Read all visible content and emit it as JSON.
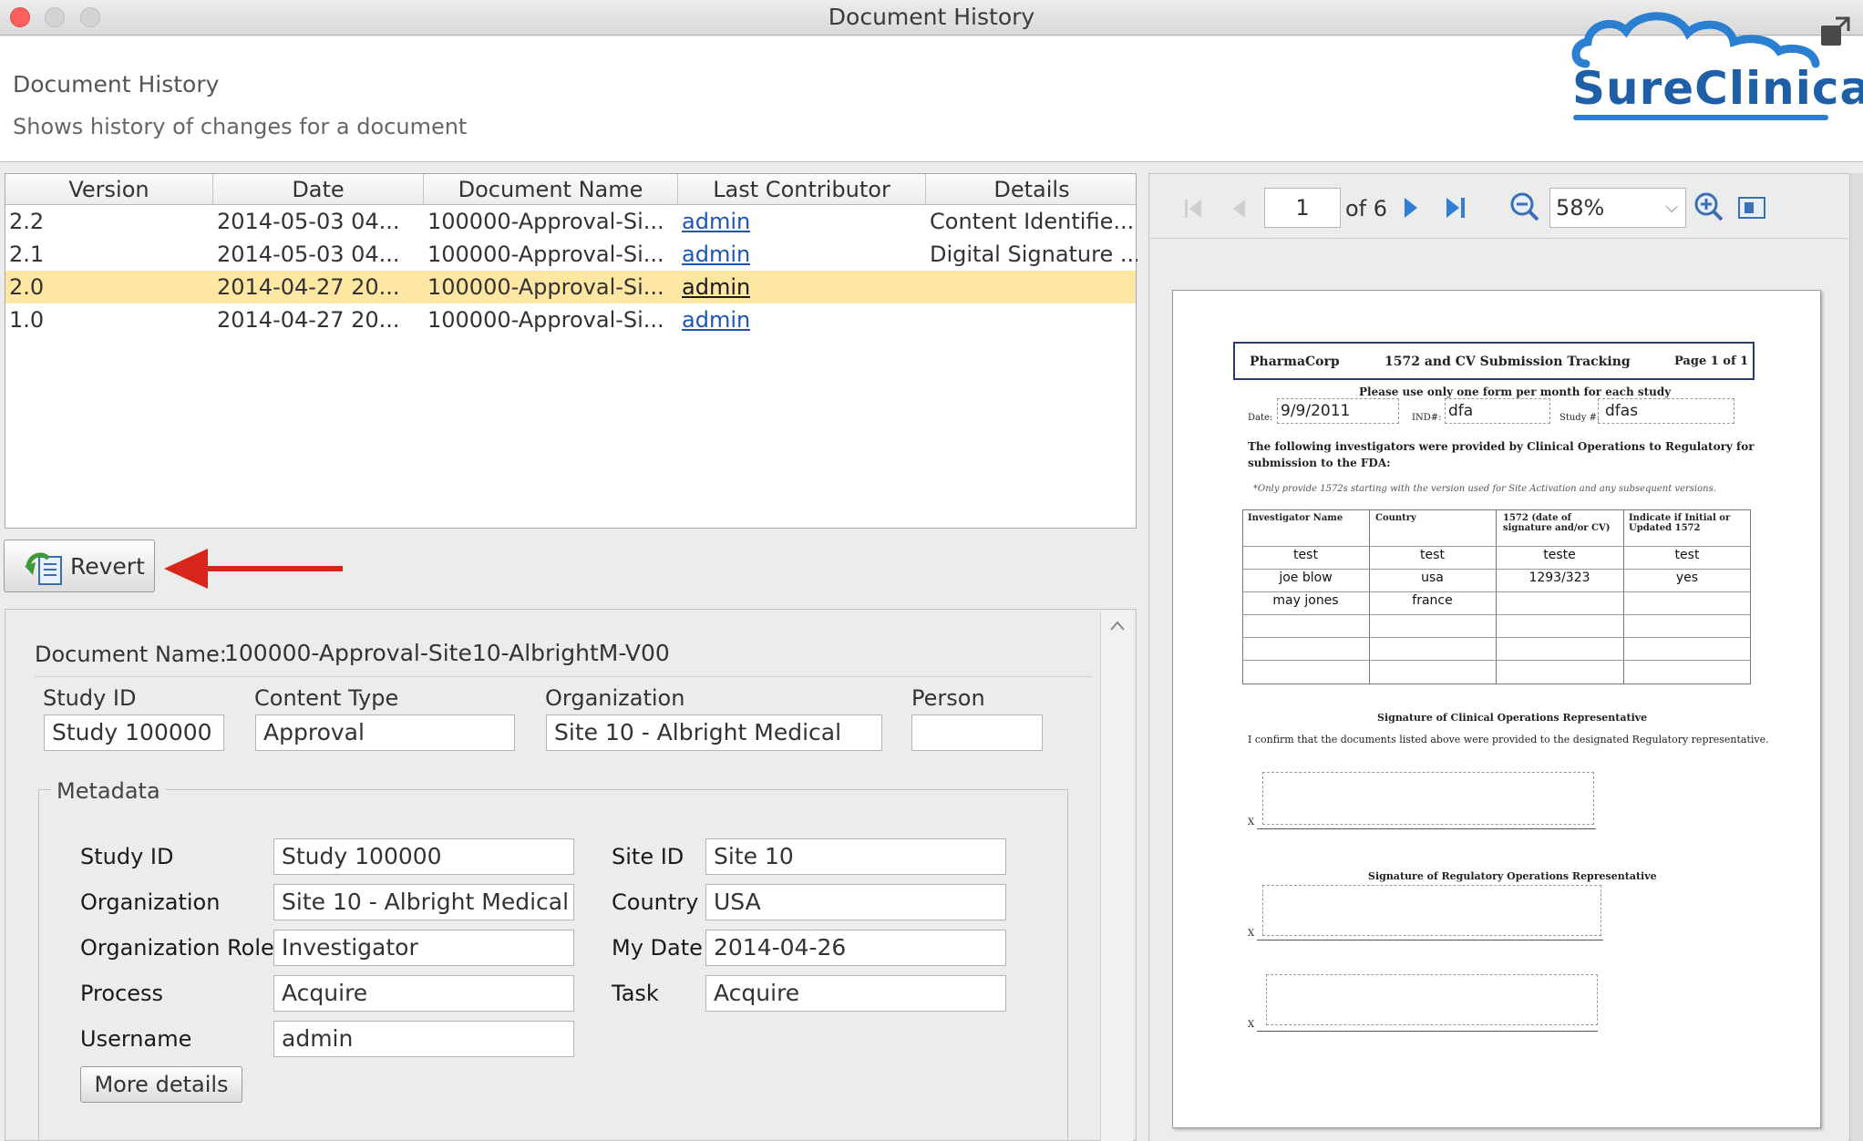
{
  "window": {
    "title": "Document History"
  },
  "header": {
    "title": "Document History",
    "subtitle": "Shows history of changes for a document",
    "logo_text": "SureClinical"
  },
  "versions": {
    "columns": [
      "Version",
      "Date",
      "Document Name",
      "Last Contributor",
      "Details"
    ],
    "rows": [
      {
        "version": "2.2",
        "date": "2014-05-03 04...",
        "name": "100000-Approval-Si...",
        "contributor": "admin",
        "details": "Content Identifie..."
      },
      {
        "version": "2.1",
        "date": "2014-05-03 04...",
        "name": "100000-Approval-Si...",
        "contributor": "admin",
        "details": "Digital Signature ..."
      },
      {
        "version": "2.0",
        "date": "2014-04-27 20...",
        "name": "100000-Approval-Si...",
        "contributor": "admin",
        "details": ""
      },
      {
        "version": "1.0",
        "date": "2014-04-27 20...",
        "name": "100000-Approval-Si...",
        "contributor": "admin",
        "details": ""
      }
    ],
    "selected_index": 2
  },
  "revert": {
    "label": "Revert"
  },
  "details": {
    "doc_name_label": "Document Name:",
    "doc_name_value": "100000-Approval-Site10-AlbrightM-V00",
    "study_id_label": "Study ID",
    "study_id_value": "Study 100000",
    "content_type_label": "Content Type",
    "content_type_value": "Approval",
    "organization_label": "Organization",
    "organization_value": "Site 10 - Albright Medical",
    "person_label": "Person",
    "person_value": ""
  },
  "metadata": {
    "title": "Metadata",
    "left": [
      {
        "label": "Study ID",
        "value": "Study 100000"
      },
      {
        "label": "Organization",
        "value": "Site 10 - Albright Medical"
      },
      {
        "label": "Organization Role",
        "value": "Investigator"
      },
      {
        "label": "Process",
        "value": "Acquire"
      },
      {
        "label": "Username",
        "value": "admin"
      }
    ],
    "right": [
      {
        "label": "Site ID",
        "value": "Site 10"
      },
      {
        "label": "Country",
        "value": "USA"
      },
      {
        "label": "My Date",
        "value": "2014-04-26"
      },
      {
        "label": "Task",
        "value": "Acquire"
      }
    ],
    "more_details_label": "More details"
  },
  "viewer": {
    "page_current": "1",
    "page_total_label": "of 6",
    "zoom": "58%"
  },
  "pdf": {
    "company": "PharmaCorp",
    "form_title": "1572 and CV Submission Tracking",
    "page_label": "Page 1 of 1",
    "instruction": "Please use only one form per month for each study",
    "date_label": "Date:",
    "date_value": "9/9/2011",
    "ind_label": "IND#:",
    "ind_value": "dfa",
    "study_label": "Study #:",
    "study_value": "dfas",
    "intro": "The following investigators were provided by Clinical Operations to Regulatory for",
    "intro2": "submission to the FDA:",
    "note": "*Only provide 1572s starting with the version used for Site Activation and any subsequent versions.",
    "table_headers": [
      "Investigator Name",
      "Country",
      "1572 (date of signature and/or CV)",
      "Indicate if Initial or Updated 1572"
    ],
    "table_rows": [
      [
        "test",
        "test",
        "teste",
        "test"
      ],
      [
        "joe blow",
        "usa",
        "1293/323",
        "yes"
      ],
      [
        "may jones",
        "france",
        "",
        ""
      ],
      [
        "",
        "",
        "",
        ""
      ],
      [
        "",
        "",
        "",
        ""
      ],
      [
        "",
        "",
        "",
        ""
      ]
    ],
    "sig1_title": "Signature of Clinical Operations Representative",
    "sig1_text": "I confirm that the documents listed above were provided to the designated Regulatory representative.",
    "sig2_title": "Signature of Regulatory Operations Representative",
    "x_mark": "X"
  },
  "colors": {
    "selected_row": "#fde7a3",
    "link": "#2054b4",
    "close_button": "#fc605c",
    "logo_blue": "#1f5fa8",
    "arrow_red": "#d8261c"
  }
}
